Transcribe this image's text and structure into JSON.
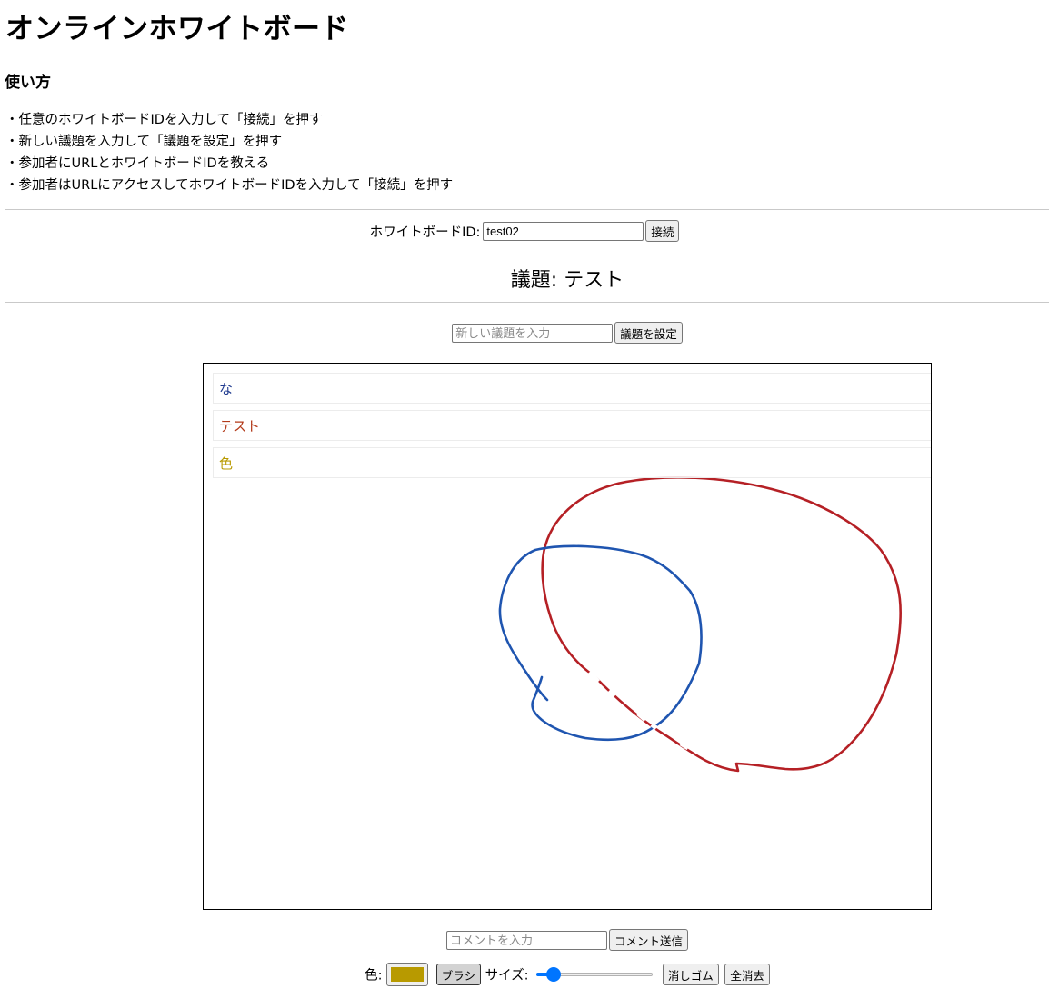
{
  "app": {
    "title": "オンラインホワイトボード"
  },
  "usage": {
    "heading": "使い方",
    "steps": [
      "・任意のホワイトボードIDを入力して「接続」を押す",
      "・新しい議題を入力して「議題を設定」を押す",
      "・参加者にURLとホワイトボードIDを教える",
      "・参加者はURLにアクセスしてホワイトボードIDを入力して「接続」を押す"
    ]
  },
  "connection": {
    "label": "ホワイトボードID:",
    "board_id_value": "test02",
    "connect_button": "接続"
  },
  "topic": {
    "display": "議題: テスト",
    "input_placeholder": "新しい議題を入力",
    "set_button": "議題を設定"
  },
  "whiteboard": {
    "comments": [
      {
        "text": "な",
        "color": "#1f3a8f"
      },
      {
        "text": "テスト",
        "color": "#b33a1a"
      },
      {
        "text": "色",
        "color": "#b89a00"
      }
    ],
    "strokes": [
      {
        "color": "#b52025"
      },
      {
        "color": "#1f55b0"
      }
    ]
  },
  "comment_input": {
    "placeholder": "コメントを入力",
    "send_button": "コメント送信"
  },
  "tools": {
    "color_label": "色:",
    "current_color": "#b89a00",
    "brush_button": "ブラシ",
    "size_label": "サイズ:",
    "size_fraction": 0.1,
    "eraser_button": "消しゴム",
    "clear_button": "全消去"
  }
}
